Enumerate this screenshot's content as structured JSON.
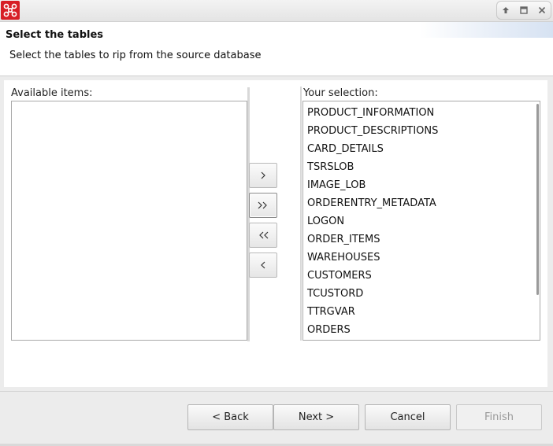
{
  "window": {
    "app_icon": "network-nodes-icon",
    "controls": [
      "up-icon",
      "restore-icon",
      "close-icon"
    ]
  },
  "header": {
    "title": "Select the tables",
    "description": "Select the tables to rip from the source database"
  },
  "available": {
    "label": "Available items:",
    "items": []
  },
  "selection": {
    "label": "Your selection:",
    "items": [
      "PRODUCT_INFORMATION",
      "PRODUCT_DESCRIPTIONS",
      "CARD_DETAILS",
      "TSRSLOB",
      "IMAGE_LOB",
      "ORDERENTRY_METADATA",
      "LOGON",
      "ORDER_ITEMS",
      "WAREHOUSES",
      "CUSTOMERS",
      "TCUSTORD",
      "TTRGVAR",
      "ORDERS"
    ]
  },
  "move_buttons": [
    "add-one-icon",
    "add-all-icon",
    "remove-all-icon",
    "remove-one-icon"
  ],
  "footer": {
    "back": "< Back",
    "next": "Next >",
    "cancel": "Cancel",
    "finish": "Finish"
  }
}
